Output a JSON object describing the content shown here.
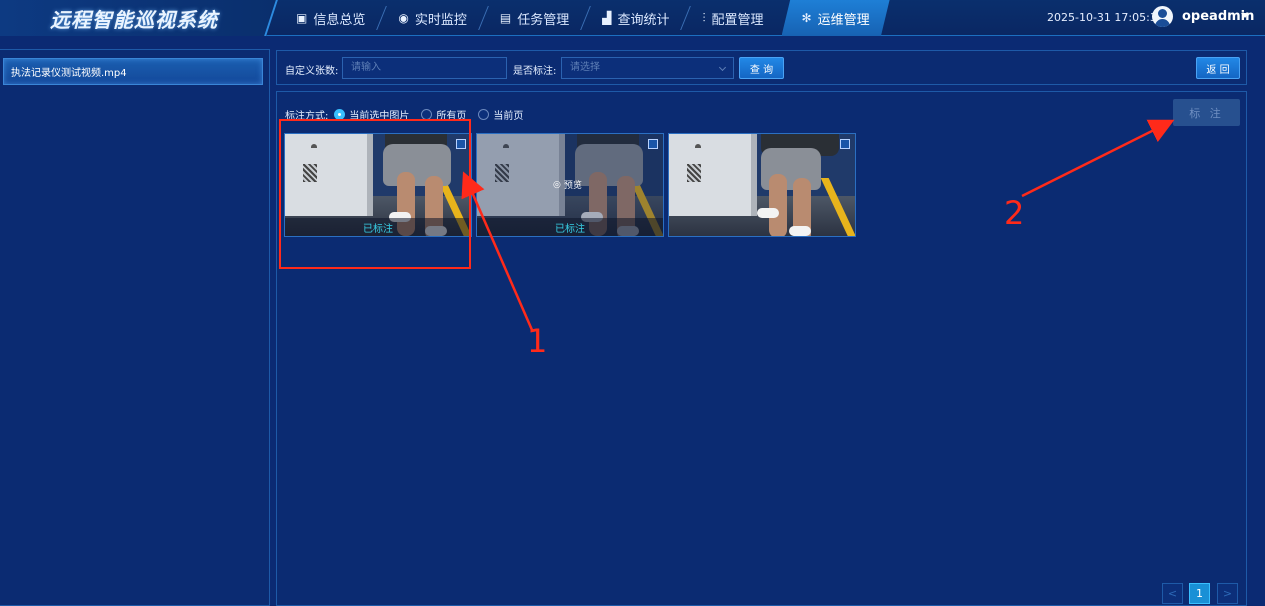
{
  "app": {
    "title": "远程智能巡视系统"
  },
  "nav": {
    "items": [
      {
        "label": "信息总览",
        "icon": "monitor-icon"
      },
      {
        "label": "实时监控",
        "icon": "location-pin-icon"
      },
      {
        "label": "任务管理",
        "icon": "task-icon"
      },
      {
        "label": "查询统计",
        "icon": "bar-chart-icon"
      },
      {
        "label": "配置管理",
        "icon": "sliders-icon"
      },
      {
        "label": "运维管理",
        "icon": "gears-icon",
        "active": true
      }
    ]
  },
  "header": {
    "datetime": "2025-10-31 17:05:35",
    "username": "opeadmin"
  },
  "sidebar": {
    "files": [
      {
        "label": "执法记录仪测试视频.mp4"
      }
    ]
  },
  "filter": {
    "count_label": "自定义张数:",
    "count_placeholder": "请输入",
    "marked_label": "是否标注:",
    "marked_placeholder": "请选择",
    "query_button": "查 询",
    "back_button": "返 回"
  },
  "mark": {
    "mode_label": "标注方式:",
    "options": [
      "当前选中图片",
      "所有页",
      "当前页"
    ],
    "selected_index": 0,
    "mark_button": "标 注"
  },
  "thumbnails": [
    {
      "label": "已标注",
      "preview": ""
    },
    {
      "label": "已标注",
      "preview": "预览"
    },
    {
      "label": "",
      "preview": ""
    }
  ],
  "pagination": {
    "prev": "<",
    "current": "1",
    "next": ">"
  },
  "annotations": {
    "num1": "1",
    "num2": "2",
    "color": "#ff2a1a"
  },
  "colors": {
    "accent": "#1990d6",
    "background": "#0b2a73",
    "marked_text": "#38d0e6"
  }
}
